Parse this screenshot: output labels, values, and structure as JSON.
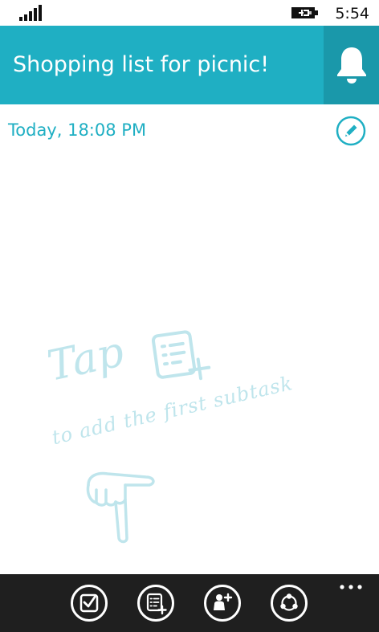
{
  "status_bar": {
    "time": "5:54",
    "signal_icon": "signal-icon",
    "battery_icon": "battery-charging-icon"
  },
  "header": {
    "title": "Shopping list for picnic!",
    "reminder_icon": "bell-icon",
    "background_color": "#1fafc3",
    "button_color": "#1a98aa"
  },
  "task": {
    "date": "Today, 18:08 PM",
    "edit_icon": "pencil-icon",
    "accent_color": "#1fafc3"
  },
  "empty_state": {
    "tap_text": "Tap",
    "hint_text": "to add the first subtask",
    "icons": [
      "add-subtask-icon",
      "pointing-hand-icon"
    ],
    "hint_color": "#bfe5ec"
  },
  "app_bar": {
    "buttons": [
      {
        "icon": "complete-check-icon"
      },
      {
        "icon": "add-subtask-icon"
      },
      {
        "icon": "add-person-icon"
      },
      {
        "icon": "share-icon"
      }
    ],
    "more_icon": "ellipsis-icon",
    "background_color": "#1f1f1f"
  }
}
